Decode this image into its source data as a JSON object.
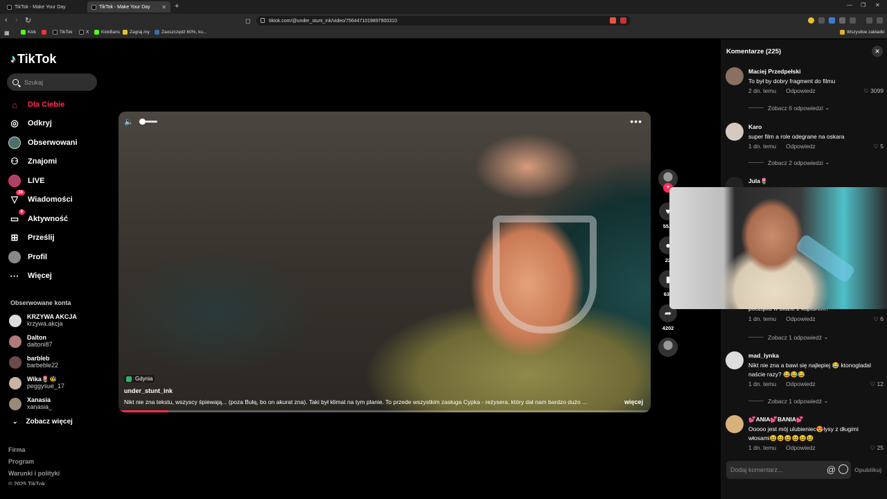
{
  "browser": {
    "tabs": [
      {
        "title": "TikTok - Make Your Day"
      },
      {
        "title": "TikTok - Make Your Day"
      }
    ],
    "url": "tiktok.com/@under_stunt_ink/video/7564471019897900310",
    "bookmarks": [
      "Kick",
      "TikTok",
      "X",
      "KickBans",
      "Zagraj.my",
      "Zaoszczędź 60%, ku..."
    ],
    "bookmarks_folder": "Wszystkie zakładki"
  },
  "sidebar": {
    "logo": "TikTok",
    "search_placeholder": "Szukaj",
    "nav": [
      {
        "label": "Dla Ciebie",
        "icon": "home-icon"
      },
      {
        "label": "Odkryj",
        "icon": "compass-icon"
      },
      {
        "label": "Obserwowani",
        "icon": "following-avatar-icon"
      },
      {
        "label": "Znajomi",
        "icon": "friends-icon"
      },
      {
        "label": "LIVE",
        "icon": "live-icon"
      },
      {
        "label": "Wiadomości",
        "icon": "messages-icon",
        "badge": "36"
      },
      {
        "label": "Aktywność",
        "icon": "activity-icon",
        "badge": "6"
      },
      {
        "label": "Prześlij",
        "icon": "upload-icon"
      },
      {
        "label": "Profil",
        "icon": "profile-icon"
      },
      {
        "label": "Więcej",
        "icon": "more-icon"
      }
    ],
    "followed_title": "Obserwowane konta",
    "followed": [
      {
        "name": "KRZYWA AKCJA",
        "handle": "krzywa.akcja"
      },
      {
        "name": "Dalton",
        "handle": "daltoni87"
      },
      {
        "name": "barbleb",
        "handle": "barbeble22"
      },
      {
        "name": "Wika🌷🐝",
        "handle": "peggysue_17"
      },
      {
        "name": "Xanasia",
        "handle": "xanasia_"
      }
    ],
    "see_more": "Zobacz więcej",
    "footer": [
      "Firma",
      "Program",
      "Warunki i polityki",
      "© 2025 TikTok"
    ]
  },
  "video": {
    "location": "Gdynia",
    "username": "under_stunt_ink",
    "description": "Nikt nie zna tekstu, wszyscy śpiewają... (poza Bułą, bo on akurat zna). Taki był klimat na tym planie.  To przede wszystkim zasługa Cypka - reżysera, który dał nam bardzo dużo ...",
    "more": "więcej",
    "progress": 0.09
  },
  "actions": {
    "likes": "55.3",
    "comments": "22",
    "saves": "635",
    "shares": "4202"
  },
  "comments": {
    "title": "Komentarze (225)",
    "items": [
      {
        "name": "Maciej Przedpełski",
        "text": "To był by dobry fragment do filmu",
        "time": "2 dn. temu",
        "reply": "Odpowiedz",
        "likes": "3099",
        "view_replies": "Zobacz 6 odpowiedzi"
      },
      {
        "name": "Karo",
        "text": "super film a role odegrane na oskara",
        "time": "1 dn. temu",
        "reply": "Odpowiedz",
        "likes": "5",
        "view_replies": "Zobacz 2 odpowiedzi"
      },
      {
        "name": "Jula🌷",
        "text": "początku w bluzie z kapturem?",
        "time": "1 dn. temu",
        "reply": "Odpowiedz",
        "likes": "6",
        "view_replies": "Zobacz 1 odpowiedź"
      },
      {
        "name": "mad_lynka",
        "text": "Nikt nie zna a bawi się najlepiej 😂 ktonogladal naście razy? 😂😂😂",
        "time": "1 dn. temu",
        "reply": "Odpowiedz",
        "likes": "12",
        "view_replies": "Zobacz 1 odpowiedź"
      },
      {
        "name": "💕ANIA💕BANIA💕",
        "text": "Ooooo jest mój ulubieniec😍łysy z długimi włosami😆😆😆😆😆😆",
        "time": "1 dn. temu",
        "reply": "Odpowiedz",
        "likes": "25"
      }
    ],
    "input_placeholder": "Dodaj komentarz...",
    "post_label": "Opublikuj"
  }
}
